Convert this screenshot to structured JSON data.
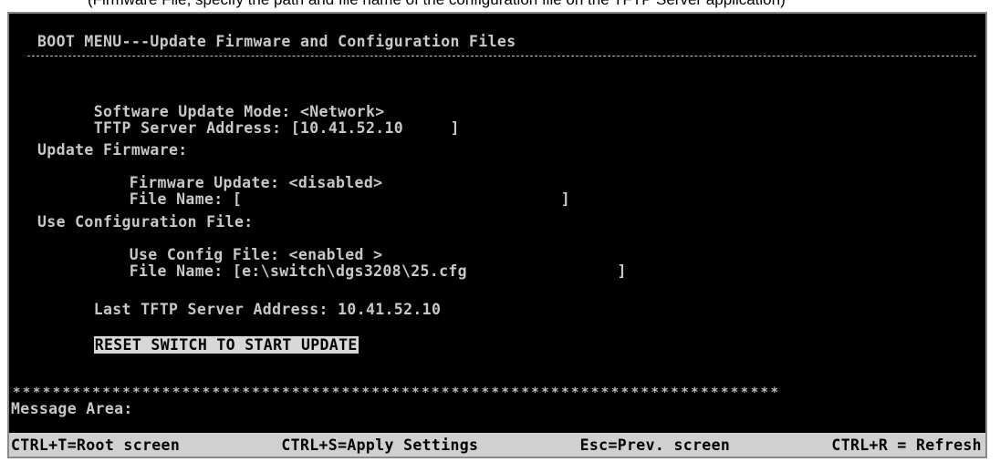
{
  "clipped_doc_text": "(Firmware File, specify the path and file name of the configuration file on the TFTP Server application)",
  "menu": {
    "title": "BOOT MENU---Update Firmware and Configuration Files"
  },
  "settings": {
    "update_mode_label": "Software Update Mode:",
    "update_mode_value": "<Network>",
    "tftp_label": "TFTP Server Address:",
    "tftp_value": "[10.41.52.10     ]",
    "update_fw_label": "Update Firmware:",
    "fw_update_label": "Firmware Update:",
    "fw_update_value": "<disabled>",
    "fw_file_label": "File Name:",
    "fw_file_value": "[                                  ]",
    "use_cfg_label": "Use Configuration File:",
    "use_cfg_file_label": "Use Config File:",
    "use_cfg_file_value": "<enabled >",
    "cfg_file_label": "File Name:",
    "cfg_file_value": "[e:\\switch\\dgs3208\\25.cfg                ]",
    "last_tftp_label": "Last TFTP Server Address:",
    "last_tftp_value": "10.41.52.10"
  },
  "actions": {
    "reset_label": "RESET SWITCH TO START UPDATE"
  },
  "separator": "*****************************************************************************",
  "message_area_label": "Message Area:",
  "footer": {
    "root_screen": "CTRL+T=Root screen",
    "apply_settings": "CTRL+S=Apply Settings",
    "prev_screen": "Esc=Prev. screen",
    "refresh": "CTRL+R = Refresh"
  }
}
